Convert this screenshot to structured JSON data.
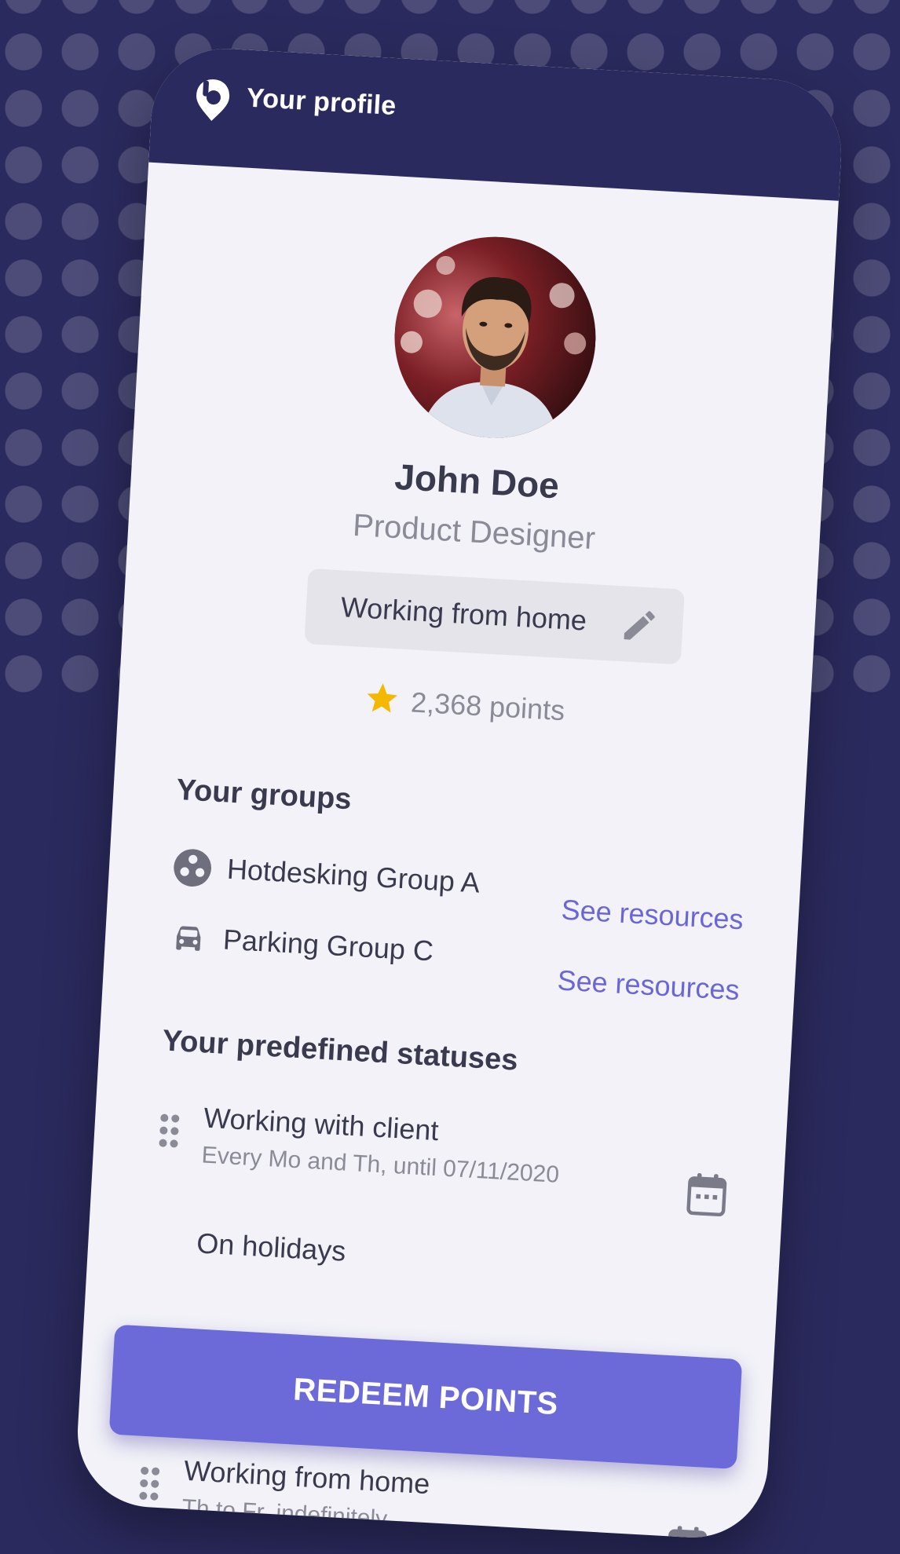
{
  "header": {
    "title": "Your profile",
    "logo_icon": "brand-logo-icon"
  },
  "profile": {
    "name": "John Doe",
    "role": "Product Designer",
    "status": "Working from home",
    "points": "2,368 points"
  },
  "groups": {
    "title": "Your groups",
    "items": [
      {
        "label": "Hotdesking Group A",
        "link": "See resources",
        "icon": "hotdesk-icon"
      },
      {
        "label": "Parking Group C",
        "link": "See resources",
        "icon": "car-icon"
      }
    ]
  },
  "statuses": {
    "title": "Your predefined statuses",
    "items": [
      {
        "name": "Working with client",
        "schedule": "Every Mo and Th, until 07/11/2020"
      },
      {
        "name": "On holidays",
        "schedule": ""
      },
      {
        "name": "Working from home",
        "schedule": "Th to Fr, indefinitely"
      }
    ]
  },
  "actions": {
    "redeem_label": "REDEEM POINTS"
  },
  "colors": {
    "background": "#2b2a5e",
    "accent": "#6c6ad8",
    "link": "#6a66d8",
    "star": "#f5b800"
  }
}
